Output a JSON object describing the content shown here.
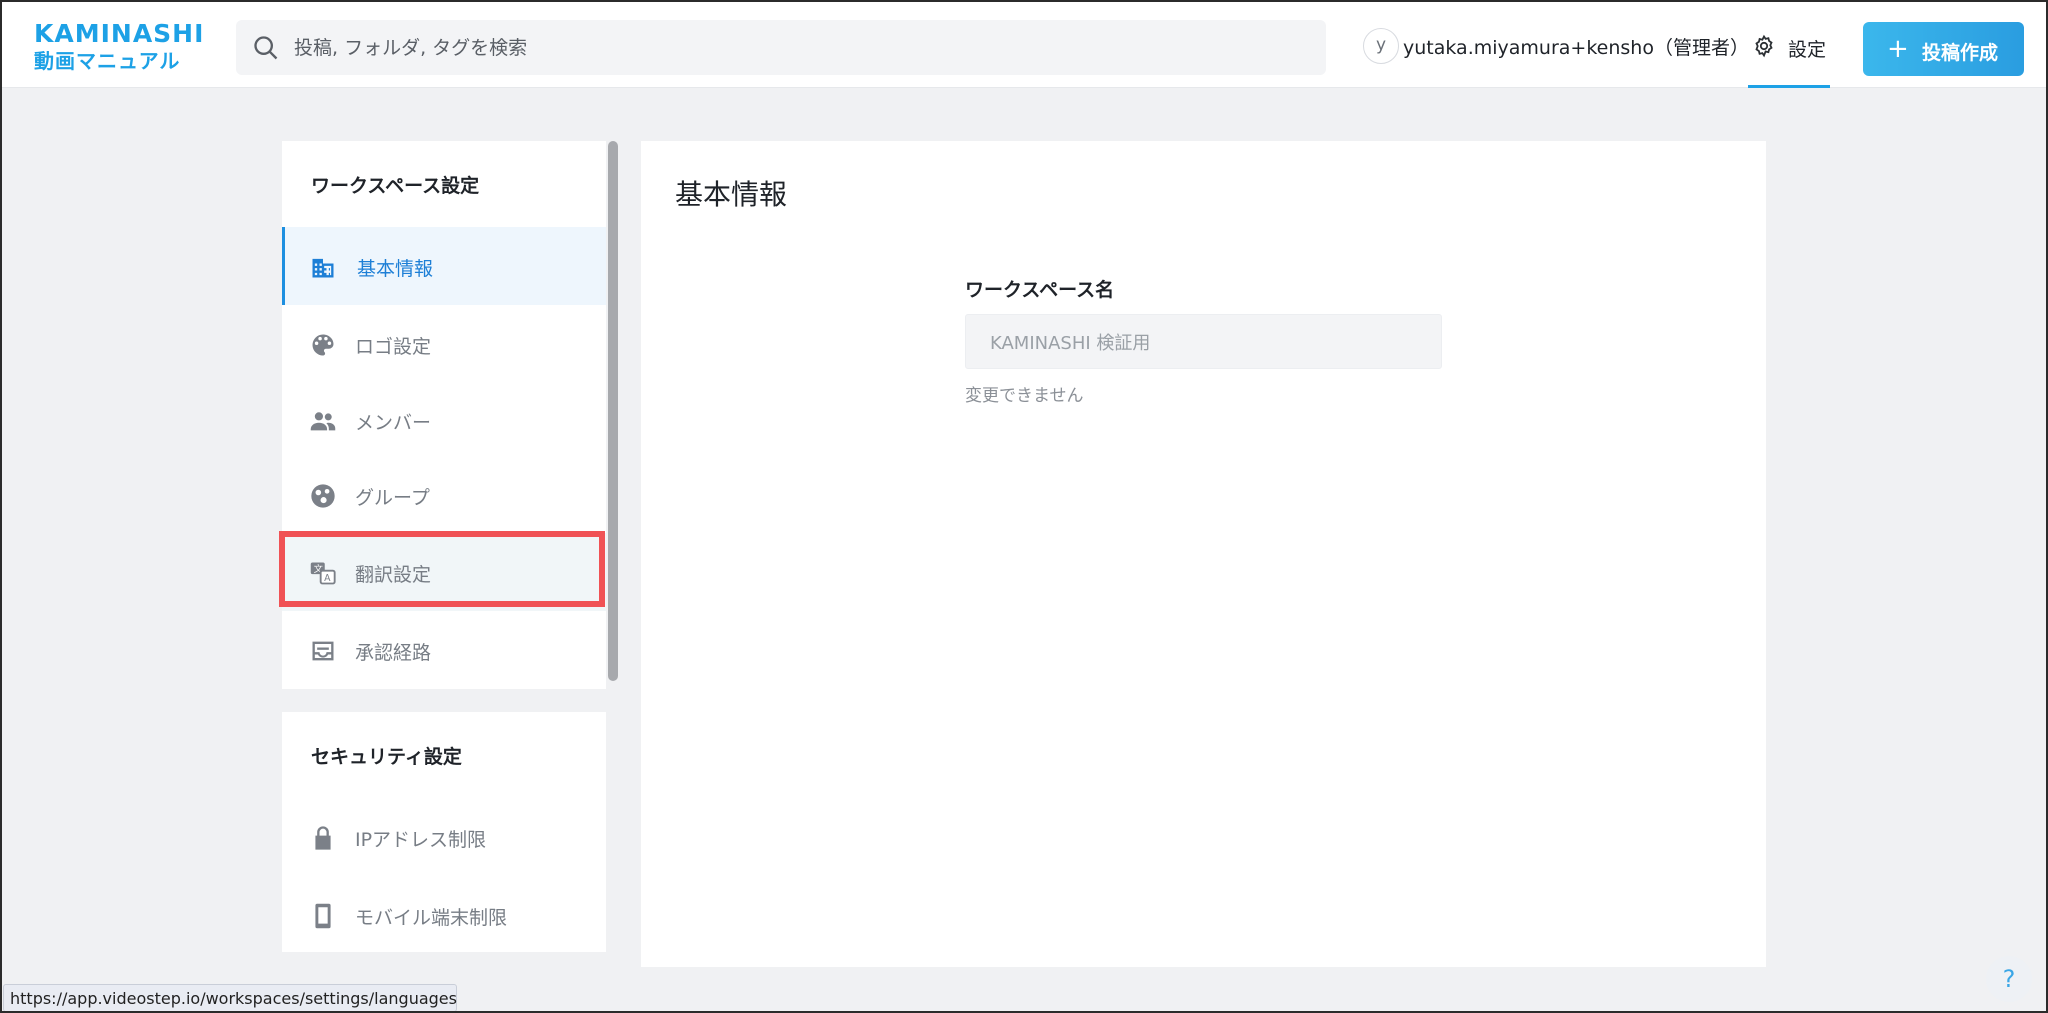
{
  "app": {
    "logo_top": "KAMINASHI",
    "logo_bottom": "動画マニュアル"
  },
  "header": {
    "search_placeholder": "投稿, フォルダ, タグを検索",
    "avatar_initial": "y",
    "user_name": "yutaka.miyamura+kensho（管理者）",
    "settings_label": "設定",
    "create_plus": "+",
    "create_label": "投稿作成"
  },
  "sidebar": {
    "workspace_title": "ワークスペース設定",
    "workspace_items": [
      {
        "label": "基本情報",
        "icon": "building-icon",
        "active": true
      },
      {
        "label": "ロゴ設定",
        "icon": "palette-icon"
      },
      {
        "label": "メンバー",
        "icon": "people-icon"
      },
      {
        "label": "グループ",
        "icon": "group-icon"
      },
      {
        "label": "翻訳設定",
        "icon": "translate-icon",
        "highlighted": true
      },
      {
        "label": "承認経路",
        "icon": "inbox-icon"
      }
    ],
    "security_title": "セキュリティ設定",
    "security_items": [
      {
        "label": "IPアドレス制限",
        "icon": "lock-icon"
      },
      {
        "label": "モバイル端末制限",
        "icon": "smartphone-icon"
      }
    ]
  },
  "main": {
    "title": "基本情報",
    "workspace_name_label": "ワークスペース名",
    "workspace_name_value": "KAMINASHI 検証用",
    "workspace_name_help": "変更できません"
  },
  "status_bar": {
    "url": "https://app.videostep.io/workspaces/settings/languages"
  },
  "help_label": "?",
  "colors": {
    "accent": "#1da1e6",
    "highlight_border": "#f05255",
    "active_bg": "#eef6fd"
  }
}
